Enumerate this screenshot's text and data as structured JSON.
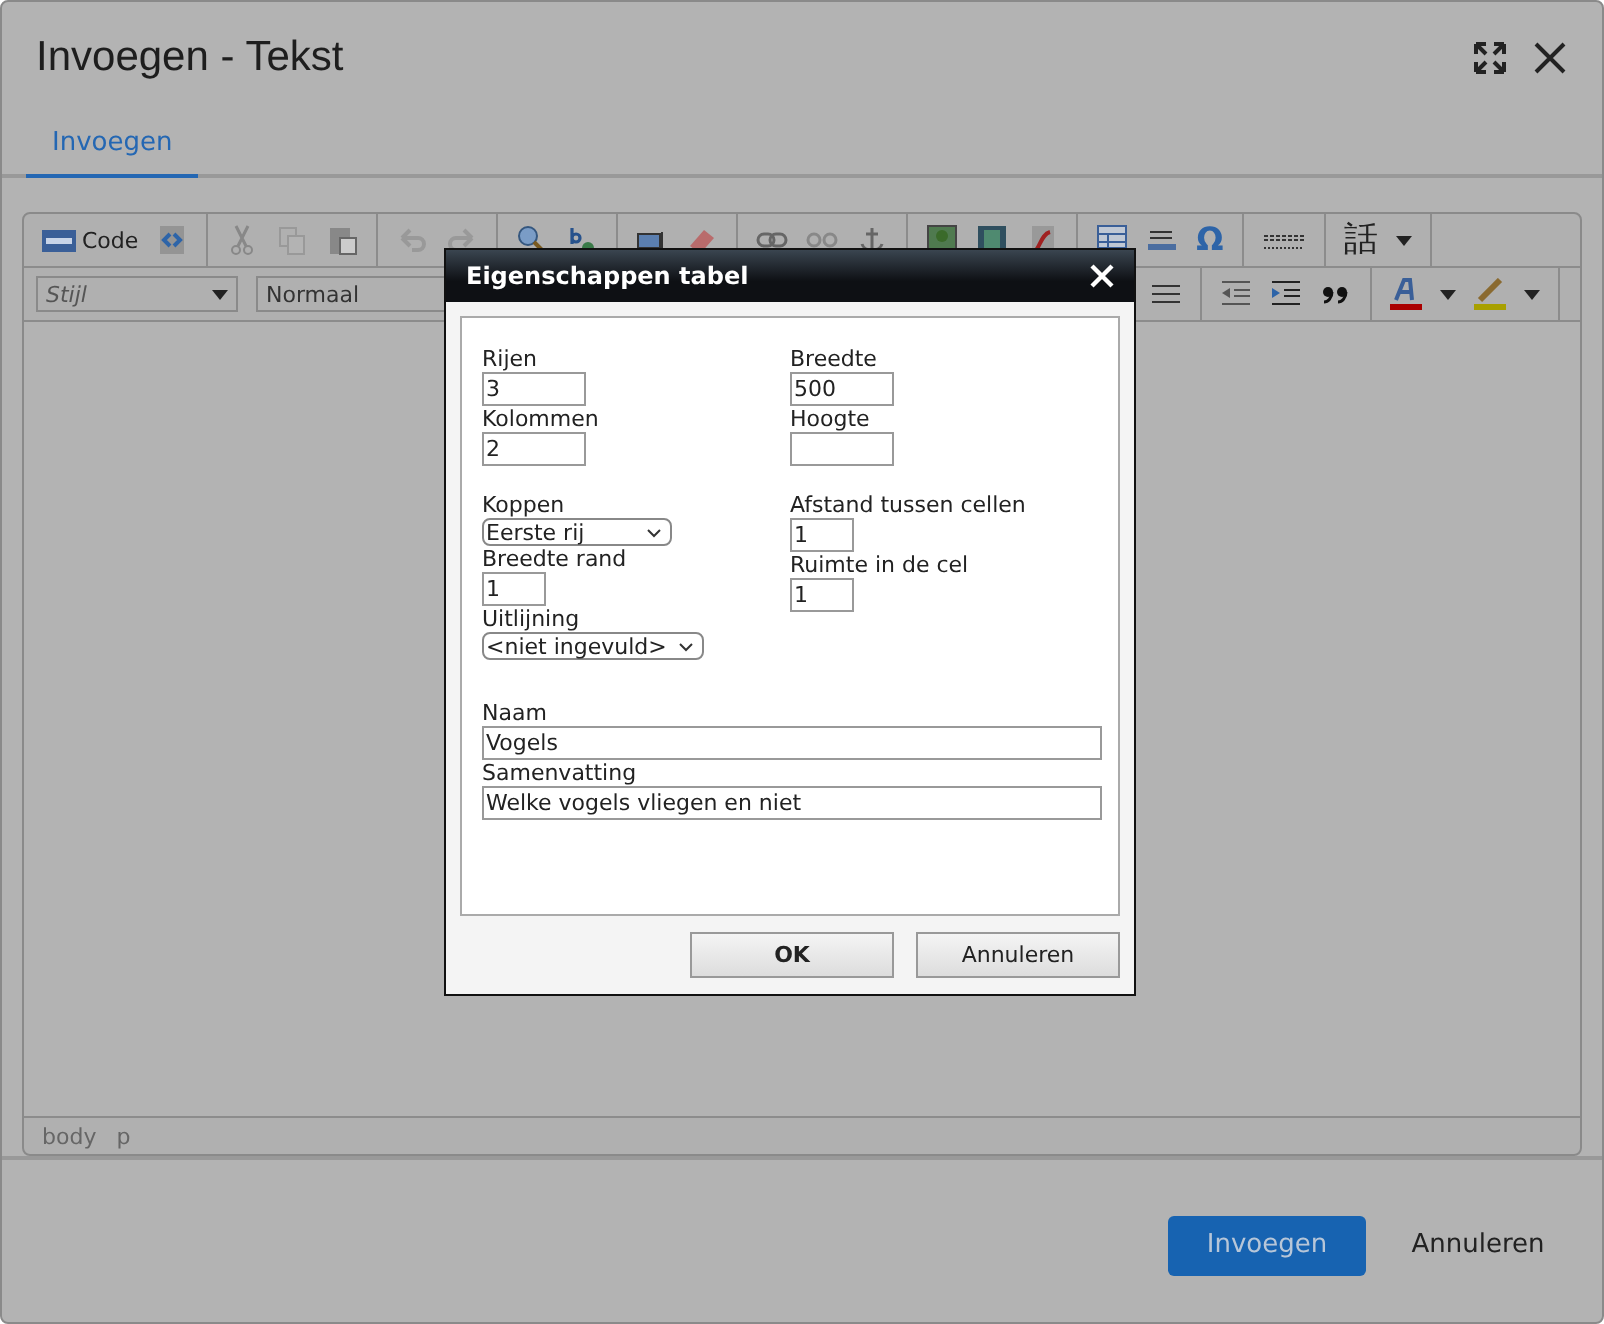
{
  "window": {
    "title": "Invoegen - Tekst"
  },
  "tabs": [
    {
      "label": "Invoegen",
      "selected": true
    }
  ],
  "toolbar": {
    "code_button": "Code",
    "style_select": "Stijl",
    "format_select": "Normaal",
    "special_char": "Ω",
    "language_icon": "話"
  },
  "status_bar": [
    "body",
    "p"
  ],
  "dialog": {
    "title": "Eigenschappen tabel",
    "sections": [
      {
        "left": [
          {
            "label": "Rijen",
            "value": "3",
            "kind": "input"
          },
          {
            "label": "Kolommen",
            "value": "2",
            "kind": "input"
          }
        ],
        "right": [
          {
            "label": "Breedte",
            "value": "500",
            "kind": "input"
          },
          {
            "label": "Hoogte",
            "kind": "input"
          }
        ]
      },
      {
        "left": [
          {
            "label": "Koppen",
            "value": "Eerste rij",
            "kind": "select"
          },
          {
            "label": "Breedte rand",
            "value": "1",
            "kind": "short"
          },
          {
            "label": "Uitlijning",
            "value": "<niet ingevuld>",
            "kind": "select"
          }
        ],
        "right": [
          {
            "label": "Afstand tussen cellen",
            "value": "1",
            "kind": "short"
          },
          {
            "label": "Ruimte in de cel",
            "value": "1",
            "kind": "short"
          }
        ]
      }
    ],
    "wide_fields": [
      {
        "label": "Naam",
        "value": "Vogels"
      },
      {
        "label": "Samenvatting",
        "value": "Welke vogels vliegen en niet"
      }
    ],
    "buttons": [
      {
        "label": "OK",
        "kind": "default"
      },
      {
        "label": "Annuleren",
        "kind": "plain"
      }
    ]
  },
  "footer_buttons": [
    {
      "label": "Invoegen",
      "kind": "primary"
    },
    {
      "label": "Annuleren",
      "kind": "plain"
    }
  ]
}
